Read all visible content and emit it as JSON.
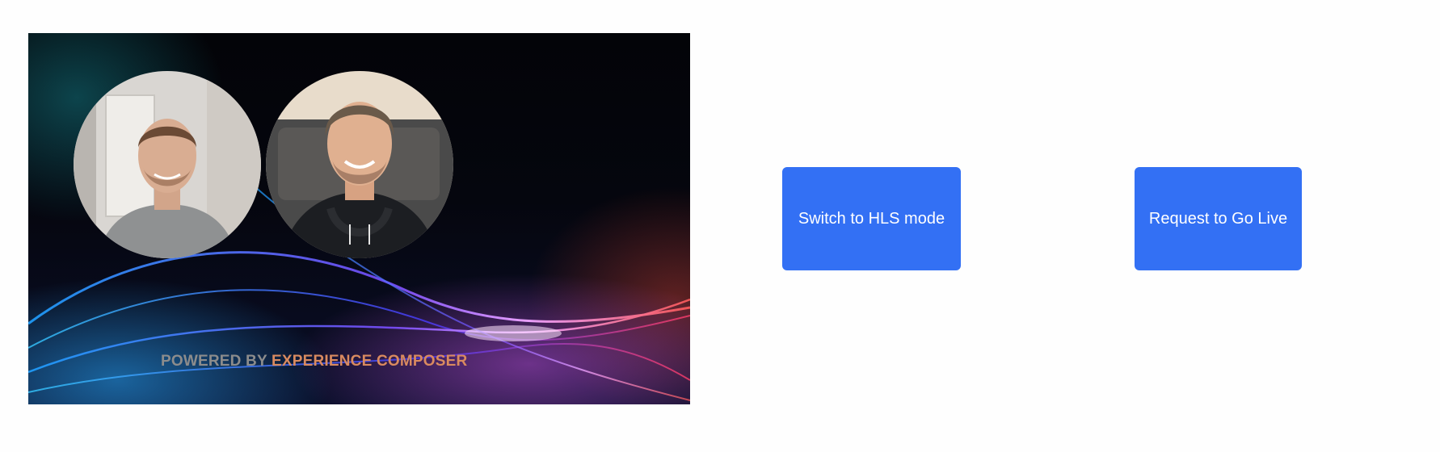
{
  "video": {
    "watermark_prefix": "POWERED BY ",
    "watermark_highlight": "EXPERIENCE COMPOSER",
    "participants": [
      {
        "avatar": "participant-video-1"
      },
      {
        "avatar": "participant-video-2"
      }
    ]
  },
  "actions": {
    "switch_hls_label": "Switch to HLS mode",
    "request_live_label": "Request to Go Live"
  },
  "colors": {
    "button_blue": "#3370f4",
    "watermark_grey": "#8c8c8c",
    "watermark_accent": "#d98a5f"
  }
}
